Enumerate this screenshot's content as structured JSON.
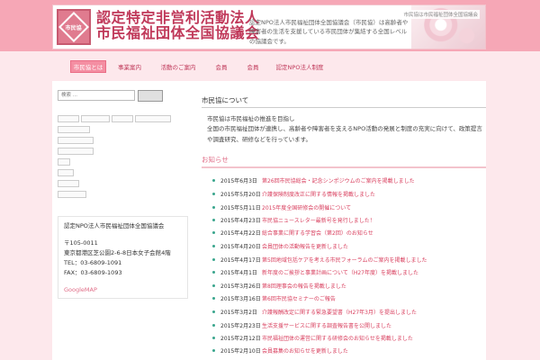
{
  "header": {
    "logo_text": "市民協",
    "title_line1": "認定特定非営利活動法人",
    "title_line2": "市民福祉団体全国協議会",
    "description": "認定NPO法人市民福祉団体全国協議会（市民協）は高齢者や障害者の生活を支援している市民団体が集結する全国レベルの協議会です。",
    "tagline": "市民協は市民福祉団体全国協議会"
  },
  "nav": {
    "items": [
      {
        "label": "市民協とは"
      },
      {
        "label": "事業案内"
      },
      {
        "label": "活動のご案内"
      },
      {
        "label": "会員"
      },
      {
        "label": "会員"
      },
      {
        "label": "認定NPO法人制度"
      }
    ]
  },
  "sidebar": {
    "search_placeholder": "検索 ...",
    "address_title": "認定NPO法人市民福祉団体全国協議会",
    "postal": "〒105-0011",
    "address": "東京都港区芝公園2-6-8日本女子会館4階",
    "tel": "TEL：03-6809-1091",
    "fax": "FAX：03-6809-1093",
    "map_link": "GoogleMAP"
  },
  "main": {
    "about_heading": "市民協について",
    "about_line1": "市民協は市民福祉の推進を目指し",
    "about_line2": "全国の市民福祉団体が連携し、高齢者や障害者を支えるNPO活動の発展と制度の充実に向けて、政策提言や調査研究、研修などを行っています。",
    "news_heading": "お知らせ",
    "news": [
      {
        "date": "2015年6月3日",
        "title": "第26回市民協総会・記念シンポジウムのご案内を掲載しました"
      },
      {
        "date": "2015年5月20日",
        "title": "介護保険制度改正に関する情報を掲載しました"
      },
      {
        "date": "2015年5月11日",
        "title": "2015年度全国研修会の開催について"
      },
      {
        "date": "2015年4月23日",
        "title": "市民協ニュースレター最新号を発行しました！"
      },
      {
        "date": "2015年4月22日",
        "title": "総合事業に関する学習会（第2回）のお知らせ"
      },
      {
        "date": "2015年4月20日",
        "title": "会員団体の活動報告を更新しました"
      },
      {
        "date": "2015年4月17日",
        "title": "第5回地域包括ケアを考える市民フォーラムのご案内を掲載しました"
      },
      {
        "date": "2015年4月1日",
        "title": "新年度のご挨拶と事業計画について（H27年度）を掲載しました"
      },
      {
        "date": "2015年3月26日",
        "title": "第8回理事会の報告を掲載しました"
      },
      {
        "date": "2015年3月16日",
        "title": "第6回市民協セミナーのご報告"
      },
      {
        "date": "2015年3月2日",
        "title": "介護報酬改定に関する緊急要望書（H27年3月）を提出しました"
      },
      {
        "date": "2015年2月23日",
        "title": "生活支援サービスに関する調査報告書を公開しました"
      },
      {
        "date": "2015年2月12日",
        "title": "市民福祉団体の運営に関する研修会のお知らせを掲載しました"
      },
      {
        "date": "2015年2月10日",
        "title": "会員募集のお知らせを更新しました"
      }
    ]
  }
}
